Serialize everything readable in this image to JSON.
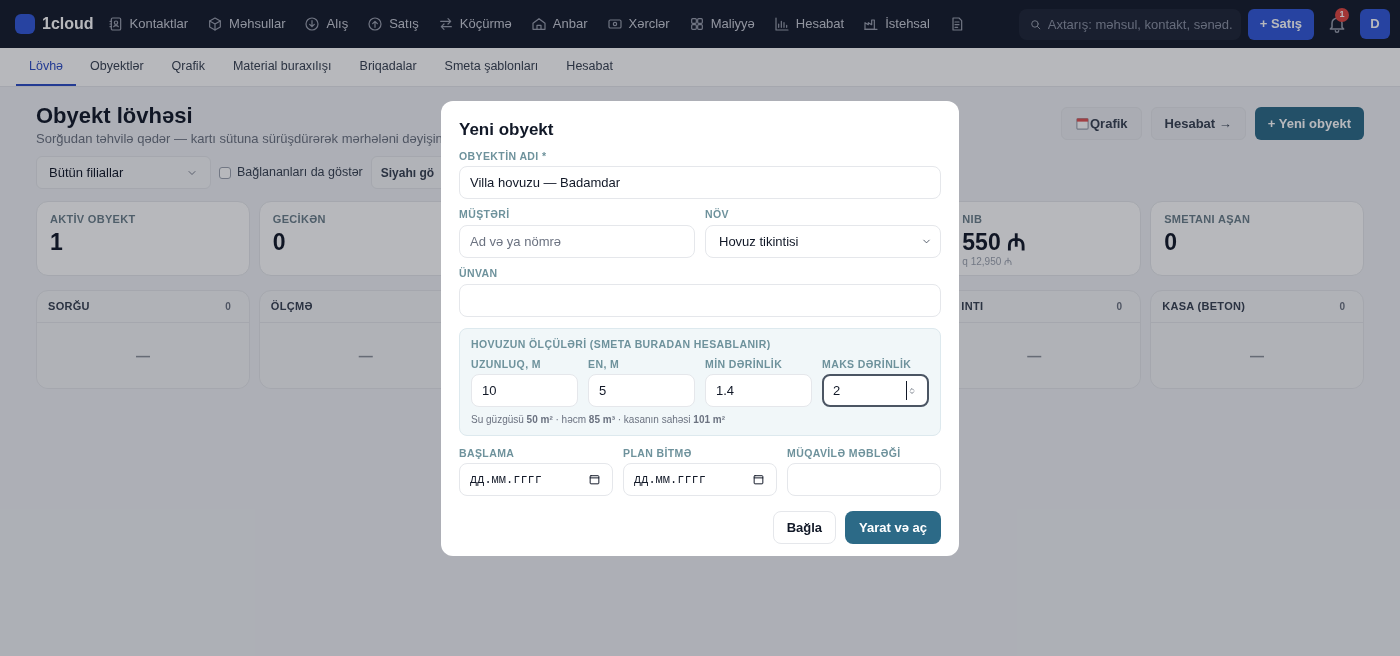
{
  "nav": {
    "brand": "1cloud",
    "items": [
      {
        "label": "Kontaktlar"
      },
      {
        "label": "Məhsullar"
      },
      {
        "label": "Alış"
      },
      {
        "label": "Satış"
      },
      {
        "label": "Köçürmə"
      },
      {
        "label": "Anbar"
      },
      {
        "label": "Xərclər"
      },
      {
        "label": "Maliyyə"
      },
      {
        "label": "Hesabat"
      },
      {
        "label": "İstehsal"
      }
    ],
    "search": {
      "placeholder": "Axtarış: məhsul, kontakt, sənəd."
    },
    "sale_button": "+ Satış",
    "notifications": "1",
    "avatar": "D"
  },
  "tabs": [
    {
      "label": "Lövhə",
      "selected": true
    },
    {
      "label": "Obyektlər",
      "selected": false
    },
    {
      "label": "Qrafik",
      "selected": false
    },
    {
      "label": "Material buraxılışı",
      "selected": false
    },
    {
      "label": "Briqadalar",
      "selected": false
    },
    {
      "label": "Smeta şablonları",
      "selected": false
    },
    {
      "label": "Hesabat",
      "selected": false
    }
  ],
  "header": {
    "title": "Obyekt lövhəsi",
    "subtitle": "Sorğudan təhvilə qədər — kartı sütuna sürüşdürərək mərhələni dəyişin",
    "buttons": [
      {
        "label": "Qrafik",
        "kind": "calendar"
      },
      {
        "label": "Hesabat →",
        "kind": "plain"
      },
      {
        "label": "+ Yeni obyekt",
        "kind": "primary"
      }
    ]
  },
  "filters": {
    "branch": "Bütün filiallar",
    "show_closed": {
      "label": "Bağlananları da göstər",
      "checked": false
    },
    "view_button": "Siyahı gö"
  },
  "stats": [
    {
      "label": "AKTİV OBYEKT",
      "value": "1"
    },
    {
      "label": "GECİKƏN",
      "value": "0"
    },
    {
      "label": "NIB",
      "value": "550 ₼",
      "note": "q 12,950 ₼"
    },
    {
      "label": "SMETANI AŞAN",
      "value": "0"
    }
  ],
  "columns": [
    {
      "title": "SORĞU",
      "count": "0",
      "empty": "—"
    },
    {
      "title": "ÖLÇMƏ",
      "empty": "—"
    },
    {
      "title": "INTI",
      "count": "0",
      "empty": "—"
    },
    {
      "title": "KASA (BETON)",
      "count": "0",
      "empty": "—"
    }
  ],
  "modal": {
    "title": "Yeni obyekt",
    "name_field": {
      "label": "OBYEKTİN ADI *",
      "value": "Villa hovuzu — Badamdar"
    },
    "customer": {
      "label": "MÜŞTƏRİ",
      "placeholder": "Ad və ya nömrə"
    },
    "type": {
      "label": "NÖV",
      "value": "Hovuz tikintisi"
    },
    "address": {
      "label": "ÜNVAN"
    },
    "dimensions": {
      "title": "HOVUZUN ÖLÇÜLƏRİ (SMETA BURADAN HESABLANIR)",
      "fields": [
        {
          "label": "UZUNLUQ, M",
          "value": "10",
          "focused": false
        },
        {
          "label": "EN, M",
          "value": "5",
          "focused": false
        },
        {
          "label": "MİN DƏRİNLİK",
          "value": "1.4",
          "focused": false
        },
        {
          "label": "MAKS DƏRİNLİK",
          "value": "2",
          "focused": true
        }
      ],
      "summary": "Su güzgüsü **50 m²** · həcm **85 m³** · kasanın sahəsi **101 m²**"
    },
    "dates": [
      {
        "label": "BAŞLAMA",
        "placeholder": "дд.мм.гггг"
      },
      {
        "label": "PLAN BİTMƏ",
        "placeholder": "дд.мм.гггг"
      }
    ],
    "contract": {
      "label": "MÜQAVİLƏ MƏBLƏĞİ"
    },
    "buttons": [
      {
        "label": "Bağla",
        "kind": "secondary"
      },
      {
        "label": "Yarat və aç",
        "kind": "primary"
      }
    ]
  }
}
